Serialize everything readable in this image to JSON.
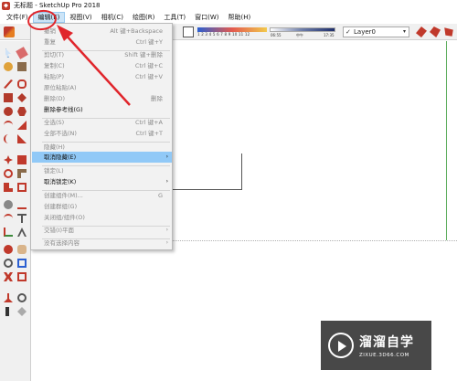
{
  "window": {
    "title": "无标题 - SketchUp Pro 2018"
  },
  "menubar": {
    "items": [
      {
        "label": "文件(F)",
        "active": false
      },
      {
        "label": "编辑(E)",
        "active": true
      },
      {
        "label": "视图(V)",
        "active": false
      },
      {
        "label": "相机(C)",
        "active": false
      },
      {
        "label": "绘图(R)",
        "active": false
      },
      {
        "label": "工具(T)",
        "active": false
      },
      {
        "label": "窗口(W)",
        "active": false
      },
      {
        "label": "帮助(H)",
        "active": false
      }
    ]
  },
  "toolbar": {
    "shadow_ticks": "1 2 3 4 5 6 7 8 9 10 11 12",
    "time_start": "06:55",
    "time_mid": "中午",
    "time_end": "17:35",
    "layer": {
      "check": "✓",
      "value": "Layer0",
      "caret": "▾"
    }
  },
  "edit_menu": {
    "items": [
      {
        "label": "撤销",
        "shortcut": "Alt 键+Backspace",
        "state": "disabled"
      },
      {
        "label": "重复",
        "shortcut": "Ctrl 键+Y",
        "state": "disabled"
      },
      {
        "label": "剪切(T)",
        "shortcut": "Shift 键+删除",
        "state": "disabled"
      },
      {
        "label": "复制(C)",
        "shortcut": "Ctrl 键+C",
        "state": "disabled"
      },
      {
        "label": "粘贴(P)",
        "shortcut": "Ctrl 键+V",
        "state": "disabled"
      },
      {
        "label": "原位粘贴(A)",
        "shortcut": "",
        "state": "disabled"
      },
      {
        "label": "删除(D)",
        "shortcut": "删除",
        "state": "disabled"
      },
      {
        "label": "删除参考线(G)",
        "shortcut": "",
        "state": "enabled"
      },
      {
        "label": "全选(S)",
        "shortcut": "Ctrl 键+A",
        "state": "disabled"
      },
      {
        "label": "全部不选(N)",
        "shortcut": "Ctrl 键+T",
        "state": "disabled"
      },
      {
        "label": "隐藏(H)",
        "shortcut": "",
        "state": "disabled"
      },
      {
        "label": "取消隐藏(E)",
        "shortcut": "",
        "state": "highlight",
        "submenu": true
      },
      {
        "label": "锁定(L)",
        "shortcut": "",
        "state": "disabled"
      },
      {
        "label": "取消锁定(K)",
        "shortcut": "",
        "state": "enabled",
        "submenu": true
      },
      {
        "label": "创建组件(M)...",
        "shortcut": "G",
        "state": "disabled"
      },
      {
        "label": "创建群组(G)",
        "shortcut": "",
        "state": "disabled"
      },
      {
        "label": "关闭组/组件(O)",
        "shortcut": "",
        "state": "disabled"
      },
      {
        "label": "交错(I)平面",
        "shortcut": "",
        "state": "disabled",
        "submenu": true
      },
      {
        "label": "没有选择内容",
        "shortcut": "",
        "state": "disabled",
        "submenu": true
      }
    ],
    "submenu_arrow": "›"
  },
  "watermark": {
    "title": "溜溜自学",
    "url": "ZIXUE.3D66.COM"
  },
  "colors": {
    "highlight": "#91c9f7",
    "menu_bg": "#f2f2f2",
    "annotation": "#e0252b"
  }
}
